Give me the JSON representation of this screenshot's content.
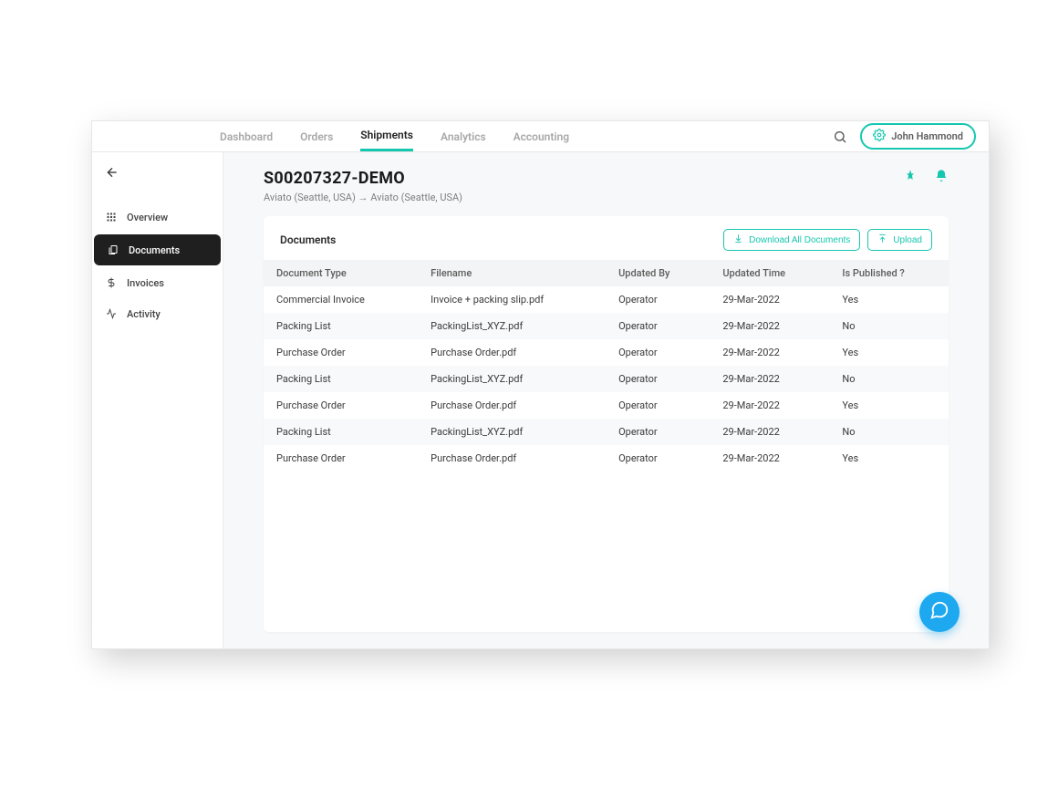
{
  "nav": {
    "items": [
      {
        "label": "Dashboard"
      },
      {
        "label": "Orders"
      },
      {
        "label": "Shipments",
        "active": true
      },
      {
        "label": "Analytics"
      },
      {
        "label": "Accounting"
      }
    ]
  },
  "user": {
    "name": "John Hammond"
  },
  "sidebar": {
    "items": [
      {
        "label": "Overview",
        "icon": "grid"
      },
      {
        "label": "Documents",
        "icon": "doc",
        "active": true
      },
      {
        "label": "Invoices",
        "icon": "dollar"
      },
      {
        "label": "Activity",
        "icon": "activity"
      }
    ]
  },
  "page": {
    "title": "S00207327-DEMO",
    "subtitle": "Aviato (Seattle, USA) → Aviato (Seattle, USA)"
  },
  "card": {
    "title": "Documents",
    "download_all": "Download All Documents",
    "upload": "Upload"
  },
  "table": {
    "headers": {
      "doctype": "Document Type",
      "filename": "Filename",
      "updated_by": "Updated By",
      "updated_time": "Updated Time",
      "published": "Is Published ?"
    },
    "rows": [
      {
        "doctype": "Commercial Invoice",
        "filename": "Invoice + packing slip.pdf",
        "updated_by": "Operator",
        "updated_time": "29-Mar-2022",
        "published": "Yes"
      },
      {
        "doctype": "Packing List",
        "filename": "PackingList_XYZ.pdf",
        "updated_by": "Operator",
        "updated_time": "29-Mar-2022",
        "published": "No"
      },
      {
        "doctype": "Purchase Order",
        "filename": "Purchase Order.pdf",
        "updated_by": "Operator",
        "updated_time": "29-Mar-2022",
        "published": "Yes"
      },
      {
        "doctype": "Packing List",
        "filename": "PackingList_XYZ.pdf",
        "updated_by": "Operator",
        "updated_time": "29-Mar-2022",
        "published": "No"
      },
      {
        "doctype": "Purchase Order",
        "filename": "Purchase Order.pdf",
        "updated_by": "Operator",
        "updated_time": "29-Mar-2022",
        "published": "Yes"
      },
      {
        "doctype": "Packing List",
        "filename": "PackingList_XYZ.pdf",
        "updated_by": "Operator",
        "updated_time": "29-Mar-2022",
        "published": "No"
      },
      {
        "doctype": "Purchase Order",
        "filename": "Purchase Order.pdf",
        "updated_by": "Operator",
        "updated_time": "29-Mar-2022",
        "published": "Yes"
      }
    ]
  }
}
